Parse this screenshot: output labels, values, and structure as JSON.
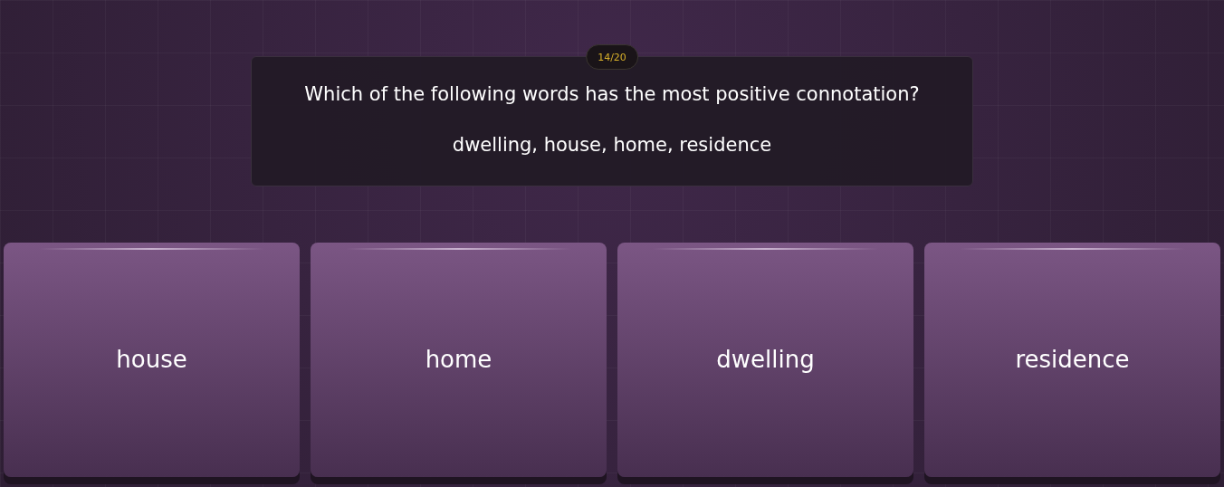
{
  "progress": "14/20",
  "question": {
    "prompt": "Which of the following words has the most positive connotation?",
    "words": "dwelling, house, home, residence"
  },
  "answers": [
    "house",
    "home",
    "dwelling",
    "residence"
  ]
}
